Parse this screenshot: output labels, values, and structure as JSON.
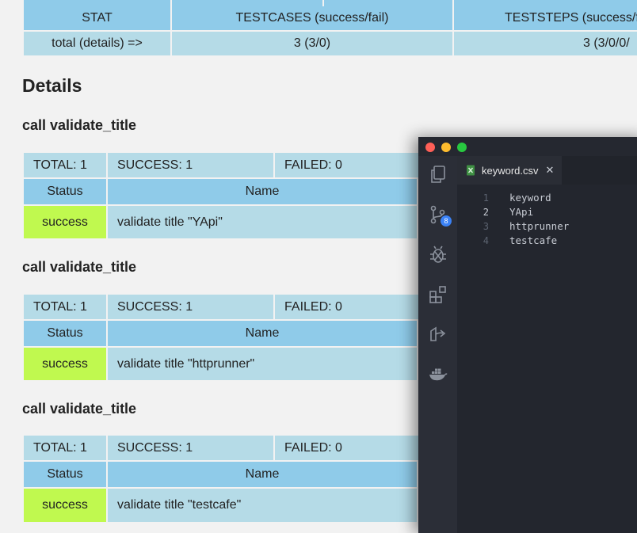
{
  "summary": {
    "headers": [
      "STAT",
      "TESTCASES (success/fail)",
      "TESTSTEPS (success/fail/"
    ],
    "row": [
      "total (details) =>",
      "3 (3/0)",
      "3 (3/0/0/"
    ]
  },
  "details_heading": "Details",
  "sections": [
    {
      "title": "call validate_title",
      "total": "TOTAL: 1",
      "success": "SUCCESS: 1",
      "failed": "FAILED: 0",
      "status_header": "Status",
      "name_header": "Name",
      "status": "success",
      "name": "validate title \"YApi\""
    },
    {
      "title": "call validate_title",
      "total": "TOTAL: 1",
      "success": "SUCCESS: 1",
      "failed": "FAILED: 0",
      "status_header": "Status",
      "name_header": "Name",
      "status": "success",
      "name": "validate title \"httprunner\""
    },
    {
      "title": "call validate_title",
      "total": "TOTAL: 1",
      "success": "SUCCESS: 1",
      "failed": "FAILED: 0",
      "status_header": "Status",
      "name_header": "Name",
      "status": "success",
      "name": "validate title \"testcafe\""
    }
  ],
  "editor": {
    "tab_label": "keyword.csv",
    "source_control_badge": "8",
    "lines": [
      {
        "num": "1",
        "text": "keyword"
      },
      {
        "num": "2",
        "text": "YApi"
      },
      {
        "num": "3",
        "text": "httprunner"
      },
      {
        "num": "4",
        "text": "testcafe"
      }
    ]
  },
  "colors": {
    "header_blue": "#8fcbe9",
    "row_blue": "#b5dbe7",
    "success_green": "#c0f94f",
    "editor_bg": "#23262e",
    "badge_blue": "#3b82f6"
  }
}
